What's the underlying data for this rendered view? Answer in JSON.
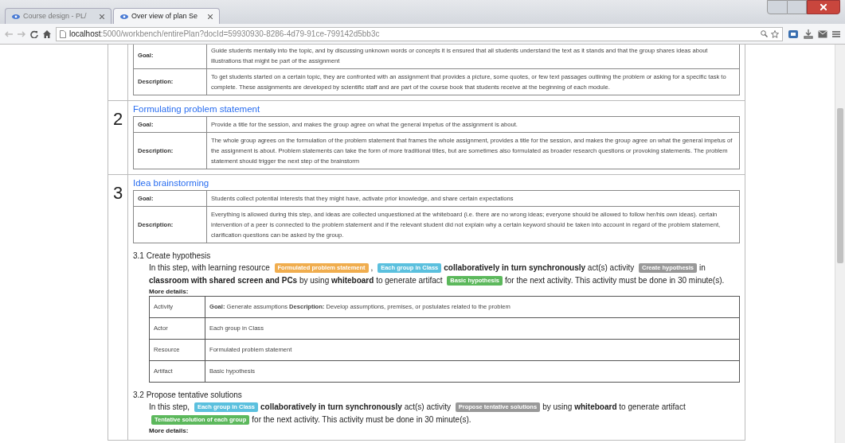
{
  "browser": {
    "tabs": [
      {
        "label": "Course design - PL/",
        "selected": false
      },
      {
        "label": "Over view of plan Se",
        "selected": true
      }
    ],
    "url_host": "localhost",
    "url_rest": ":5000/workbench/entirePlan?docId=59930930-8286-4d79-91ce-799142d5bb3c"
  },
  "steps": [
    {
      "rows": [
        {
          "label": "Goal:",
          "text": "Guide students mentally into the topic, and by discussing unknown words or concepts it is ensured that all students understand the text as it stands and that the group shares ideas about illustrations that might be part of the assignment"
        },
        {
          "label": "Description:",
          "text": "To get students started on a certain topic, they are confronted with an assignment that provides a picture, some quotes, or few text passages outlining the problem or asking for a specific task to complete. These assignments are developed by scientific staff and are part of the course book that students receive at the beginning of each module."
        }
      ]
    },
    {
      "number": "2",
      "title": "Formulating problem statement",
      "rows": [
        {
          "label": "Goal:",
          "text": "Provide a title for the session, and makes the group agree on what the general impetus of the assignment is about."
        },
        {
          "label": "Description:",
          "text": "The whole group agrees on the formulation of the problem statement that frames the whole assignment, provides a title for the session, and makes the group agree on what the general impetus of the assignment is about. Problem statements can take the form of more traditional titles, but are sometimes also formulated as broader research questions or provoking statements. The problem statement should trigger the next step of the brainstorm"
        }
      ]
    },
    {
      "number": "3",
      "title": "Idea brainstorming",
      "rows": [
        {
          "label": "Goal:",
          "text": "Students collect potential interests that they might have, activate prior knowledge, and share certain expectations"
        },
        {
          "label": "Description:",
          "text": "Everything is allowed during this step, and ideas are collected unquestioned at the whiteboard (i.e. there are no wrong ideas; everyone should be allowed to follow her/his own ideas). certain intervention of a peer is connected to the problem statement and if the relevant student did not explain why a certain keyword should be taken into account in regard of the problem statement, clarification questions can be asked by the group."
        }
      ],
      "substeps": [
        {
          "title": "3.1 Create hypothesis",
          "segments": [
            {
              "kind": "text",
              "text": "In this step, with learning resource"
            },
            {
              "kind": "badge",
              "text": "Formulated problem statement",
              "color": "#f0ad4e"
            },
            {
              "kind": "text",
              "text": ","
            },
            {
              "kind": "badge",
              "text": "Each group in Class",
              "color": "#5bc0de"
            },
            {
              "kind": "bold",
              "text": "collaboratively in turn synchronously"
            },
            {
              "kind": "text",
              "text": "act(s) activity"
            },
            {
              "kind": "badge",
              "text": "Create hypothesis",
              "color": "#999999"
            },
            {
              "kind": "text",
              "text": "in"
            },
            {
              "kind": "bold",
              "text": "classroom with shared screen and PCs"
            },
            {
              "kind": "text",
              "text": "by using"
            },
            {
              "kind": "bold",
              "text": "whiteboard"
            },
            {
              "kind": "text",
              "text": "to generate artifact"
            },
            {
              "kind": "badge",
              "text": "Basic hypothesis",
              "color": "#5cb85c"
            },
            {
              "kind": "text",
              "text": "for the next activity. This activity must be done in 30 minute(s)."
            }
          ],
          "details_label": "More details:",
          "details": [
            {
              "label": "Activity",
              "text": "**Goal:** Generate assumptions **Description:** Develop assumptions, premises, or postulates related to the problem"
            },
            {
              "label": "Actor",
              "text": "Each group in Class"
            },
            {
              "label": "Resource",
              "text": "Formulated problem statement"
            },
            {
              "label": "Artifact",
              "text": "Basic hypothesis"
            }
          ]
        },
        {
          "title": "3.2 Propose tentative solutions",
          "segments": [
            {
              "kind": "text",
              "text": "In this step,"
            },
            {
              "kind": "badge",
              "text": "Each group in Class",
              "color": "#5bc0de"
            },
            {
              "kind": "bold",
              "text": "collaboratively in turn synchronously"
            },
            {
              "kind": "text",
              "text": "act(s) activity"
            },
            {
              "kind": "badge",
              "text": "Propose tentative solutions",
              "color": "#999999"
            },
            {
              "kind": "text",
              "text": "by using"
            },
            {
              "kind": "bold",
              "text": "whiteboard"
            },
            {
              "kind": "text",
              "text": "to generate artifact"
            },
            {
              "kind": "badge",
              "text": "Tentative solution of each group",
              "color": "#5cb85c"
            },
            {
              "kind": "text",
              "text": "for the next activity. This activity must be done in 30 minute(s)."
            }
          ],
          "details_label": "More details:"
        }
      ]
    }
  ]
}
